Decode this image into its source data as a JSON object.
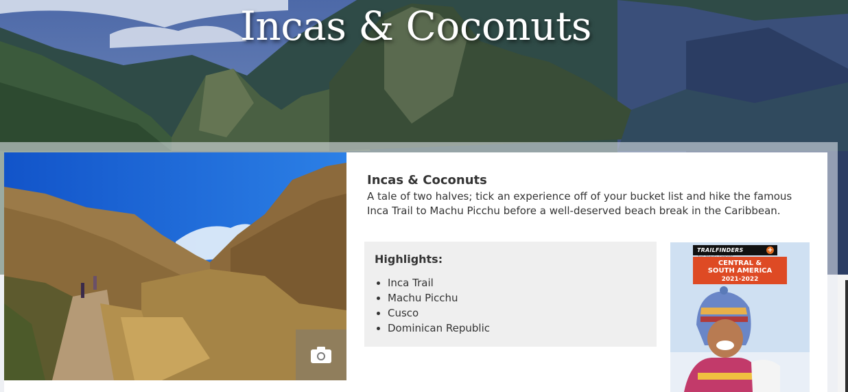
{
  "hero": {
    "title": "Incas & Coconuts"
  },
  "card": {
    "title": "Incas & Coconuts",
    "description": "A tale of two halves; tick an experience off of your bucket list and hike the famous Inca Trail to Machu Picchu before a well-deserved beach break in the Caribbean."
  },
  "photo": {
    "gallery_icon": "camera-icon"
  },
  "highlights": {
    "heading": "Highlights:",
    "items": [
      "Inca Trail",
      "Machu Picchu",
      "Cusco",
      "Dominican Republic"
    ]
  },
  "brochure": {
    "brand": "TRAILFINDERS",
    "tagline": "THE TRAVEL EXPERTS",
    "region_line1": "CENTRAL &",
    "region_line2": "SOUTH AMERICA",
    "years": "2021-2022"
  },
  "colors": {
    "brochure_red": "#de4a24",
    "sky_blue": "#1d63d4",
    "highlights_bg": "#efefef"
  }
}
